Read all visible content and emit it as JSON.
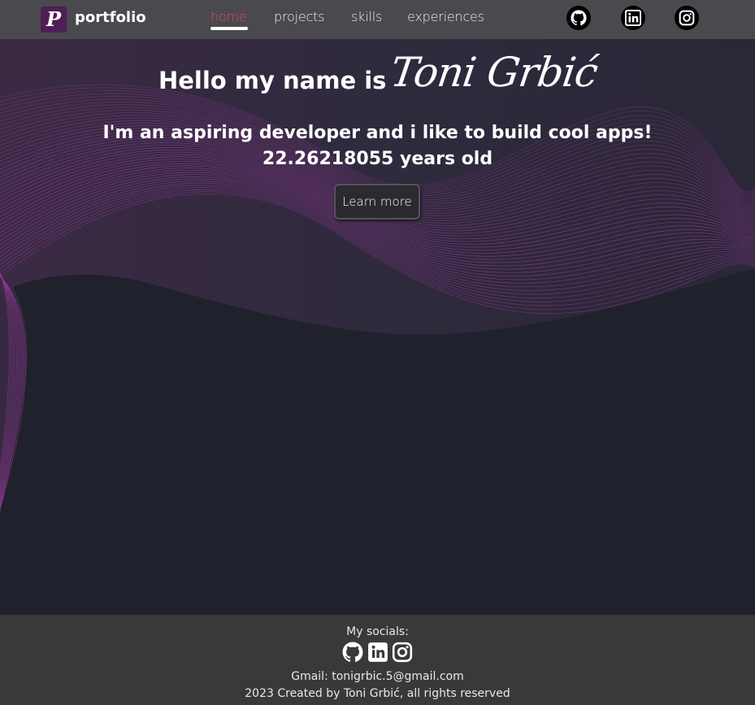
{
  "nav": {
    "brand": "portfolio",
    "logo_letter": "P",
    "links": [
      "home",
      "projects",
      "skills",
      "experiences"
    ],
    "active_link": "home",
    "socials": [
      "github-icon",
      "linkedin-icon",
      "instagram-icon"
    ]
  },
  "hero": {
    "greeting": "Hello my name is",
    "name": "Toni Grbić",
    "tagline": "I'm an aspiring developer and i like to build cool apps!",
    "age": "22.26218055 years old",
    "cta_label": "Learn more"
  },
  "footer": {
    "title": "My socials:",
    "icons": [
      "github-icon",
      "linkedin-icon",
      "instagram-icon"
    ],
    "gmail": "Gmail: tonigrbic.5@gmail.com",
    "copyright": "2023 Created by Toni Grbić, all rights reserved"
  },
  "colors": {
    "navbar": "#4a494e",
    "page_background": "#1f212c",
    "accent_purple": "#9c3a9f",
    "active_link": "#e8475c",
    "footer": "#393939"
  }
}
